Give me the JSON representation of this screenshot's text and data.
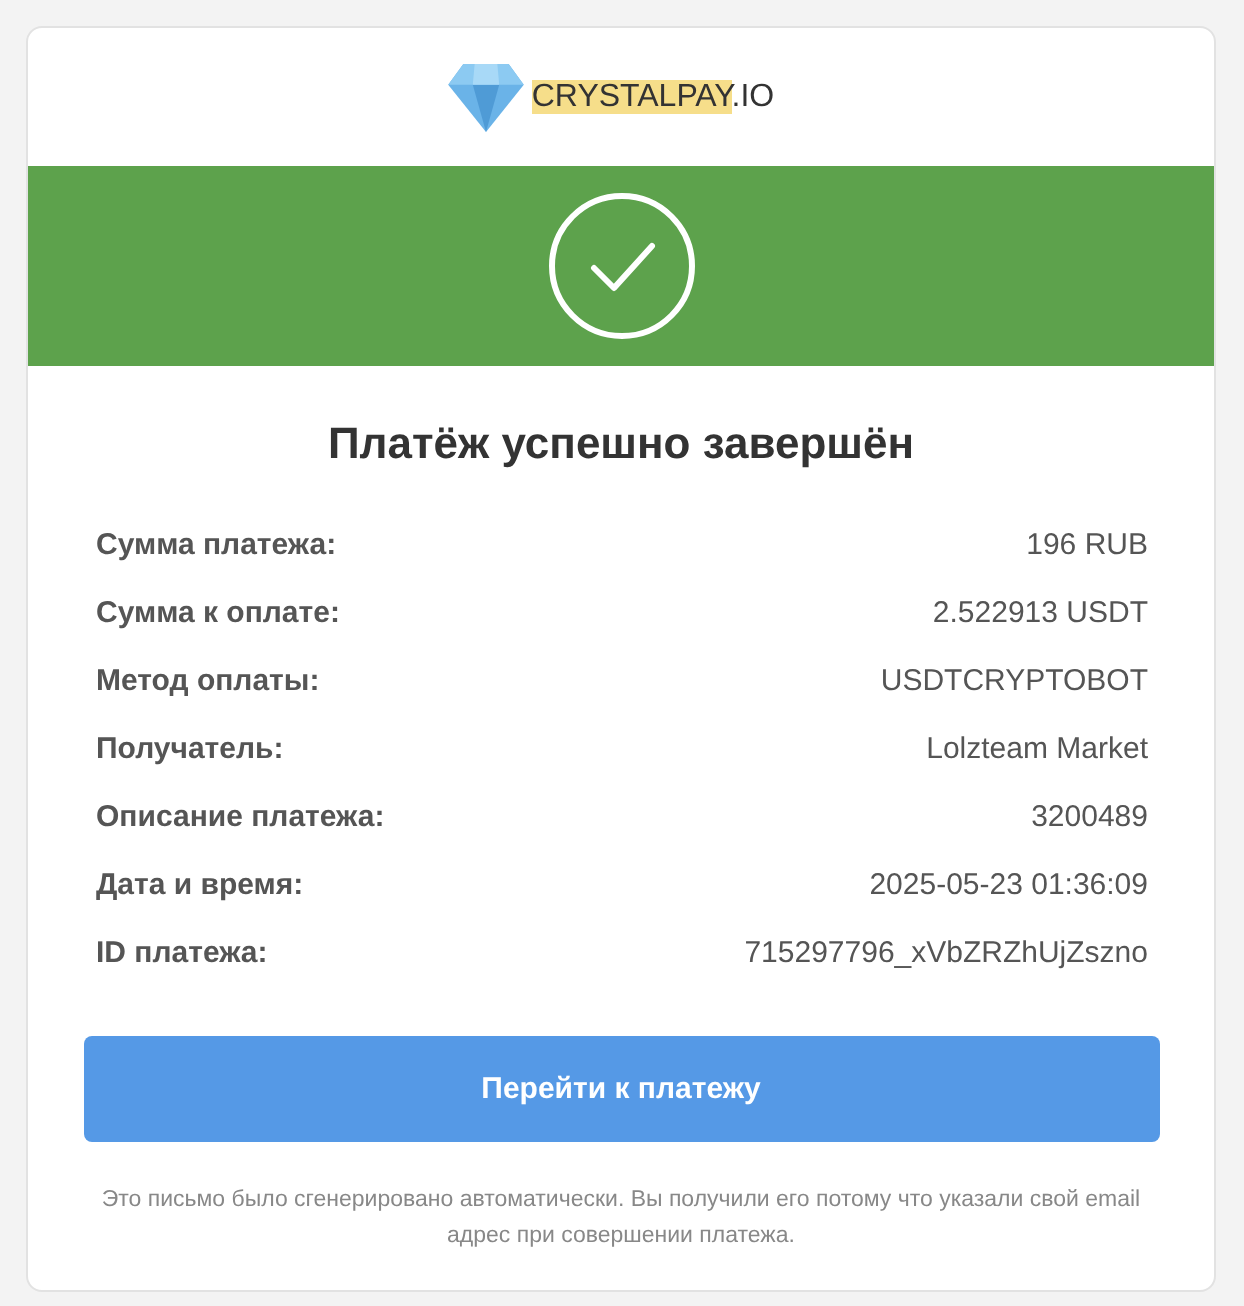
{
  "logo": {
    "highlight": "CRYSTALPAY",
    "rest": ".IO"
  },
  "status": {
    "kind": "success"
  },
  "title": "Платёж успешно завершён",
  "details": [
    {
      "label": "Сумма платежа:",
      "value": "196 RUB"
    },
    {
      "label": "Сумма к оплате:",
      "value": "2.522913 USDT"
    },
    {
      "label": "Метод оплаты:",
      "value": "USDTCRYPTOBOT"
    },
    {
      "label": "Получатель:",
      "value": "Lolzteam Market"
    },
    {
      "label": "Описание платежа:",
      "value": "3200489"
    },
    {
      "label": "Дата и время:",
      "value": "2025-05-23 01:36:09"
    },
    {
      "label": "ID платежа:",
      "value": "715297796_xVbZRZhUjZszno"
    }
  ],
  "button": "Перейти к платежу",
  "footer": "Это письмо было сгенерировано автоматически. Вы получили его потому что указали свой email адрес при совершении платежа."
}
